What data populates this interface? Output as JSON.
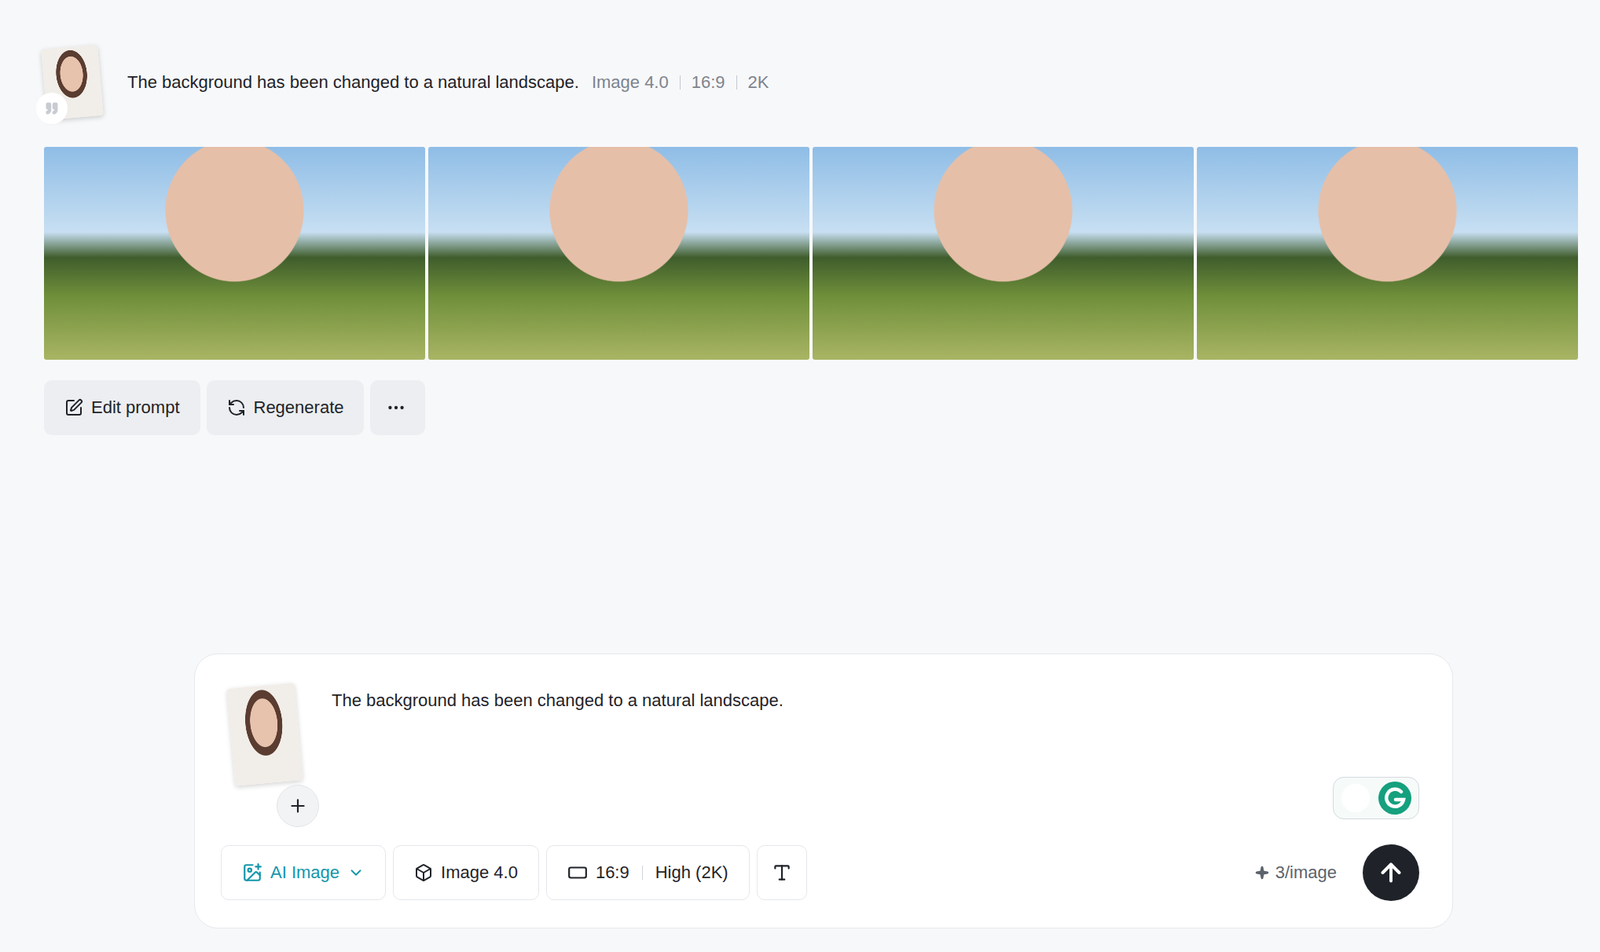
{
  "history": {
    "prompt": "The background has been changed to a natural landscape.",
    "meta": [
      "Image 4.0",
      "16:9",
      "2K"
    ],
    "actions": [
      {
        "label": "Edit prompt",
        "kind": "edit"
      },
      {
        "label": "Regenerate",
        "kind": "regenerate"
      }
    ]
  },
  "composer": {
    "prompt": "The background has been changed to a natural landscape.",
    "mode": "AI Image",
    "model": "Image 4.0",
    "ratio": "16:9",
    "quality": "High (2K)",
    "cost": "3/image"
  }
}
